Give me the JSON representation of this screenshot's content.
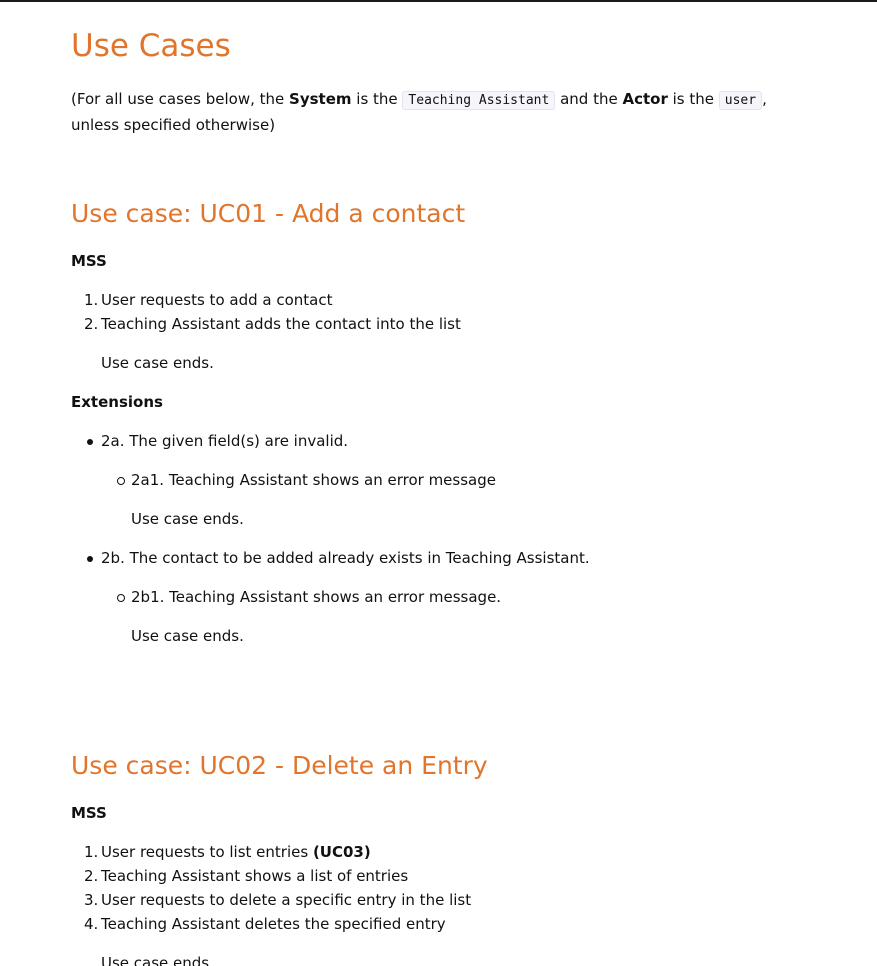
{
  "page_title": "Use Cases",
  "intro": {
    "prefix": "(For all use cases below, the ",
    "system_label": "System",
    "mid1": " is the ",
    "system_value": "Teaching Assistant",
    "mid2": " and the ",
    "actor_label": "Actor",
    "mid3": " is the ",
    "actor_value": "user",
    "suffix": ", unless specified otherwise)"
  },
  "uc01": {
    "title": "Use case: UC01 - Add a contact",
    "mss_label": "MSS",
    "steps": [
      {
        "num": "1.",
        "text": "User requests to add a contact"
      },
      {
        "num": "2.",
        "text": "Teaching Assistant adds the contact into the list"
      }
    ],
    "ends": "Use case ends.",
    "extensions_label": "Extensions",
    "ext_2a": "2a. The given field(s) are invalid.",
    "ext_2a1": "2a1. Teaching Assistant shows an error message",
    "ext_2a_ends": "Use case ends.",
    "ext_2b": "2b. The contact to be added already exists in Teaching Assistant.",
    "ext_2b1": "2b1. Teaching Assistant shows an error message.",
    "ext_2b_ends": "Use case ends."
  },
  "uc02": {
    "title": "Use case: UC02 - Delete an Entry",
    "mss_label": "MSS",
    "steps": [
      {
        "num": "1.",
        "text": "User requests to list entries ",
        "bold": "(UC03)"
      },
      {
        "num": "2.",
        "text": "Teaching Assistant shows a list of entries"
      },
      {
        "num": "3.",
        "text": "User requests to delete a specific entry in the list"
      },
      {
        "num": "4.",
        "text": "Teaching Assistant deletes the specified entry"
      }
    ],
    "ends": "Use case ends."
  }
}
